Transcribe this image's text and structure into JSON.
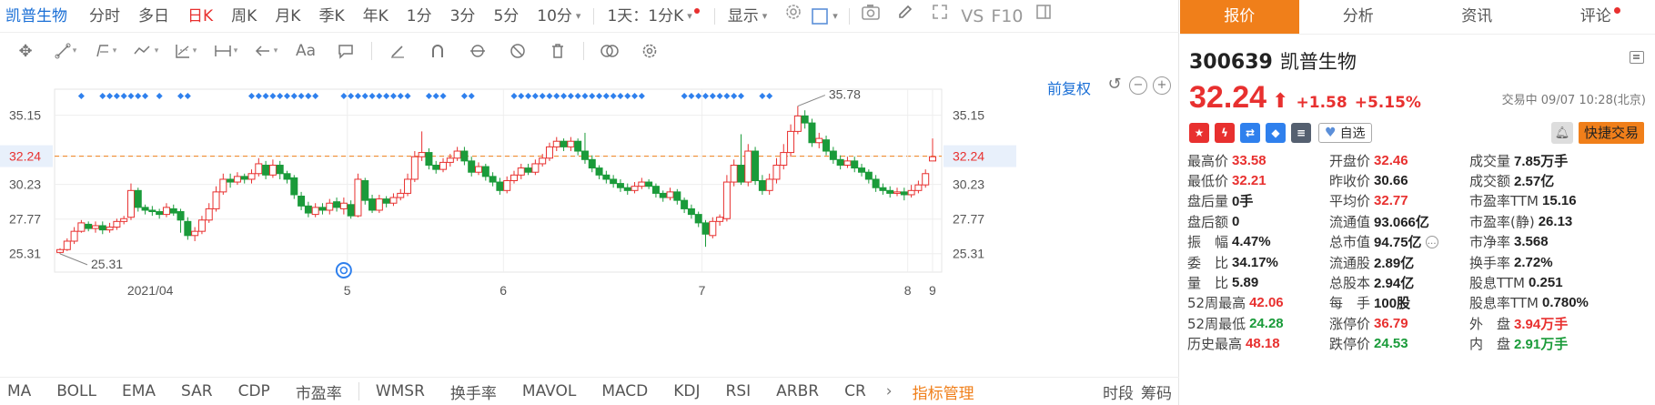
{
  "toolbar": {
    "stock_name": "凯普生物",
    "periods": [
      "分时",
      "多日",
      "日K",
      "周K",
      "月K",
      "季K",
      "年K",
      "1分",
      "3分",
      "5分",
      "10分"
    ],
    "active_period": "日K",
    "multi_period": "1天：1分K",
    "display": "显示",
    "vs_label": "VS",
    "f10_label": "F10"
  },
  "drawing_tools": [
    "move-tool",
    "line-tool",
    "channel-tool",
    "wave-tool",
    "fibonacci-tool",
    "range-tool",
    "arrow-tool",
    "text-tool",
    "note-tool",
    "pen-tool",
    "magnet-tool",
    "hide-tool",
    "lock-tool",
    "delete-tool",
    "toggle-tool",
    "settings-tool"
  ],
  "chart_controls": {
    "adjust_label": "前复权"
  },
  "chart_data": {
    "type": "candlestick",
    "y_ticks": [
      "35.15",
      "32.24",
      "30.23",
      "27.77",
      "25.31"
    ],
    "x_ticks": [
      "2021/04",
      "5",
      "6",
      "7",
      "8",
      "9"
    ],
    "ylim": [
      24.0,
      37.0
    ],
    "max_label": "35.78",
    "min_label": "25.31",
    "current_price": 32.24,
    "current_price_label": "32.24",
    "candles": [
      [
        25.4,
        25.6,
        25.3,
        25.7
      ],
      [
        25.6,
        26.2,
        25.5,
        26.4
      ],
      [
        26.2,
        26.9,
        26.0,
        27.2
      ],
      [
        26.9,
        27.5,
        26.8,
        27.7
      ],
      [
        27.4,
        27.1,
        26.9,
        27.6
      ],
      [
        27.1,
        27.3,
        26.8,
        27.6
      ],
      [
        27.3,
        27.0,
        26.7,
        27.6
      ],
      [
        27.0,
        27.2,
        26.8,
        27.5
      ],
      [
        27.2,
        27.6,
        27.0,
        27.8
      ],
      [
        27.6,
        27.8,
        27.4,
        28.0
      ],
      [
        27.9,
        29.8,
        27.7,
        30.3
      ],
      [
        29.8,
        28.6,
        28.3,
        30.0
      ],
      [
        28.6,
        28.4,
        28.1,
        28.8
      ],
      [
        28.4,
        28.3,
        28.0,
        28.7
      ],
      [
        28.3,
        28.1,
        27.8,
        28.5
      ],
      [
        28.1,
        28.6,
        27.9,
        28.9
      ],
      [
        28.5,
        28.2,
        28.0,
        28.8
      ],
      [
        28.3,
        27.7,
        26.8,
        28.5
      ],
      [
        27.6,
        26.6,
        26.3,
        27.9
      ],
      [
        26.6,
        26.9,
        26.2,
        27.2
      ],
      [
        26.9,
        27.7,
        26.7,
        28.0
      ],
      [
        27.7,
        28.5,
        27.5,
        28.9
      ],
      [
        28.5,
        29.7,
        28.3,
        30.1
      ],
      [
        29.7,
        30.6,
        29.5,
        31.0
      ],
      [
        30.6,
        30.4,
        30.0,
        31.0
      ],
      [
        30.4,
        30.8,
        30.2,
        31.1
      ],
      [
        30.8,
        30.6,
        30.3,
        31.0
      ],
      [
        30.6,
        31.0,
        30.3,
        31.3
      ],
      [
        31.0,
        31.7,
        30.8,
        32.1
      ],
      [
        31.6,
        30.9,
        30.6,
        31.9
      ],
      [
        30.9,
        31.6,
        30.7,
        32.0
      ],
      [
        31.6,
        31.0,
        30.6,
        31.9
      ],
      [
        31.0,
        30.6,
        30.3,
        31.2
      ],
      [
        30.7,
        29.5,
        29.2,
        30.9
      ],
      [
        29.4,
        28.7,
        28.4,
        29.7
      ],
      [
        28.7,
        28.2,
        27.9,
        29.0
      ],
      [
        28.1,
        28.6,
        27.9,
        28.9
      ],
      [
        28.6,
        28.4,
        28.1,
        28.9
      ],
      [
        28.4,
        28.9,
        28.1,
        29.2
      ],
      [
        29.0,
        28.6,
        28.3,
        29.3
      ],
      [
        28.5,
        28.9,
        28.1,
        29.3
      ],
      [
        28.8,
        28.0,
        27.8,
        29.1
      ],
      [
        28.0,
        30.6,
        27.9,
        31.0
      ],
      [
        30.5,
        29.1,
        28.8,
        30.7
      ],
      [
        29.2,
        28.4,
        28.2,
        29.5
      ],
      [
        28.4,
        29.2,
        28.2,
        29.5
      ],
      [
        29.2,
        28.9,
        28.6,
        29.4
      ],
      [
        28.9,
        29.3,
        28.7,
        29.6
      ],
      [
        29.3,
        29.6,
        29.1,
        29.9
      ],
      [
        29.6,
        30.6,
        29.4,
        31.0
      ],
      [
        30.6,
        32.2,
        30.4,
        32.6
      ],
      [
        32.2,
        32.5,
        31.9,
        34.0
      ],
      [
        32.5,
        31.6,
        31.3,
        32.8
      ],
      [
        31.6,
        31.3,
        31.0,
        31.9
      ],
      [
        31.3,
        31.8,
        31.1,
        32.1
      ],
      [
        31.8,
        32.1,
        31.5,
        32.4
      ],
      [
        32.1,
        32.6,
        31.9,
        32.9
      ],
      [
        32.6,
        31.9,
        31.6,
        32.9
      ],
      [
        31.9,
        31.1,
        30.8,
        32.2
      ],
      [
        31.1,
        31.5,
        30.9,
        31.8
      ],
      [
        31.5,
        30.8,
        30.5,
        31.7
      ],
      [
        30.8,
        30.4,
        30.1,
        31.1
      ],
      [
        30.4,
        29.8,
        29.5,
        30.7
      ],
      [
        29.8,
        30.5,
        29.6,
        30.8
      ],
      [
        30.5,
        30.9,
        30.3,
        31.2
      ],
      [
        30.9,
        31.4,
        30.6,
        31.7
      ],
      [
        31.4,
        31.1,
        30.9,
        31.7
      ],
      [
        31.1,
        31.7,
        30.9,
        32.0
      ],
      [
        31.7,
        32.1,
        31.5,
        32.4
      ],
      [
        32.1,
        32.9,
        31.9,
        33.2
      ],
      [
        32.9,
        33.3,
        32.6,
        33.6
      ],
      [
        33.3,
        32.9,
        32.6,
        33.5
      ],
      [
        32.9,
        33.3,
        32.6,
        33.6
      ],
      [
        33.3,
        32.6,
        32.3,
        33.5
      ],
      [
        32.6,
        32.0,
        31.7,
        33.9
      ],
      [
        32.0,
        31.4,
        31.1,
        32.3
      ],
      [
        31.4,
        30.9,
        30.6,
        31.6
      ],
      [
        30.9,
        30.6,
        30.3,
        31.2
      ],
      [
        30.6,
        30.3,
        30.0,
        30.9
      ],
      [
        30.3,
        30.0,
        29.7,
        30.6
      ],
      [
        30.0,
        29.8,
        29.5,
        30.3
      ],
      [
        29.8,
        30.1,
        29.6,
        30.4
      ],
      [
        30.1,
        30.4,
        29.9,
        30.7
      ],
      [
        30.4,
        30.1,
        29.9,
        30.6
      ],
      [
        30.1,
        29.6,
        29.3,
        30.3
      ],
      [
        29.6,
        29.3,
        29.0,
        29.8
      ],
      [
        29.3,
        29.7,
        29.1,
        30.0
      ],
      [
        29.7,
        29.1,
        28.8,
        29.9
      ],
      [
        29.1,
        28.5,
        28.2,
        29.3
      ],
      [
        28.5,
        28.1,
        27.8,
        28.8
      ],
      [
        28.1,
        27.5,
        27.2,
        28.3
      ],
      [
        27.5,
        26.7,
        25.8,
        27.7
      ],
      [
        26.6,
        27.6,
        26.4,
        27.9
      ],
      [
        27.6,
        27.9,
        27.3,
        28.1
      ],
      [
        27.8,
        30.4,
        27.6,
        30.9
      ],
      [
        30.4,
        31.6,
        30.1,
        32.0
      ],
      [
        31.6,
        30.4,
        30.2,
        33.8
      ],
      [
        30.4,
        32.6,
        30.1,
        33.1
      ],
      [
        32.6,
        30.5,
        30.2,
        32.9
      ],
      [
        30.5,
        29.8,
        29.5,
        30.9
      ],
      [
        29.8,
        30.6,
        29.5,
        31.0
      ],
      [
        30.6,
        31.6,
        30.3,
        32.1
      ],
      [
        31.6,
        32.5,
        31.3,
        33.1
      ],
      [
        32.5,
        34.0,
        32.2,
        34.5
      ],
      [
        34.0,
        35.1,
        33.8,
        35.8
      ],
      [
        35.1,
        34.6,
        34.2,
        35.5
      ],
      [
        34.6,
        33.2,
        32.9,
        34.9
      ],
      [
        33.2,
        33.5,
        32.8,
        33.9
      ],
      [
        33.4,
        32.6,
        32.3,
        33.7
      ],
      [
        32.6,
        32.0,
        31.7,
        32.9
      ],
      [
        32.0,
        31.6,
        31.3,
        32.3
      ],
      [
        31.6,
        31.9,
        31.4,
        32.2
      ],
      [
        31.9,
        31.4,
        31.1,
        32.2
      ],
      [
        31.4,
        31.1,
        30.8,
        31.7
      ],
      [
        31.1,
        30.6,
        30.3,
        31.3
      ],
      [
        30.6,
        30.0,
        29.7,
        30.9
      ],
      [
        30.0,
        29.8,
        29.5,
        30.3
      ],
      [
        29.8,
        29.6,
        29.3,
        30.1
      ],
      [
        29.6,
        29.7,
        29.4,
        30.0
      ],
      [
        29.7,
        29.5,
        29.1,
        30.0
      ],
      [
        29.5,
        29.8,
        29.3,
        30.2
      ],
      [
        29.8,
        30.2,
        29.6,
        30.5
      ],
      [
        30.2,
        31.0,
        30.0,
        31.3
      ],
      [
        31.9,
        32.2,
        32.0,
        33.5
      ]
    ],
    "signal_groups": [
      [
        3,
        1
      ],
      [
        6,
        3
      ],
      [
        9,
        3
      ],
      [
        12,
        1
      ],
      [
        14,
        1
      ],
      [
        17,
        2
      ],
      [
        27,
        9
      ],
      [
        35,
        2
      ],
      [
        40,
        10
      ],
      [
        52,
        3
      ],
      [
        57,
        2
      ],
      [
        64,
        19
      ],
      [
        88,
        9
      ],
      [
        99,
        2
      ]
    ]
  },
  "indicators": {
    "left": [
      "MA",
      "BOLL",
      "EMA",
      "SAR",
      "CDP",
      "市盈率"
    ],
    "right": [
      "WMSR",
      "换手率",
      "MAVOL",
      "MACD",
      "KDJ",
      "RSI",
      "ARBR",
      "CR"
    ],
    "manage": "指标管理",
    "extra": [
      "时段",
      "筹码"
    ]
  },
  "quote": {
    "tabs": [
      "报价",
      "分析",
      "资讯",
      "评论"
    ],
    "code": "300639",
    "name": "凯普生物",
    "price": "32.24",
    "change": "+1.58",
    "change_pct": "+5.15%",
    "status": "交易中 09/07 10:28(北京)",
    "watch_label": "自选",
    "quick_trade": "快捷交易",
    "icons": [
      {
        "name": "china-flag-icon",
        "color": "#e8302f"
      },
      {
        "name": "lightning-icon",
        "color": "#e8302f"
      },
      {
        "name": "shuffle-icon",
        "color": "#2f80ed"
      },
      {
        "name": "tag-icon",
        "color": "#2f80ed"
      },
      {
        "name": "document-icon",
        "color": "#556070"
      }
    ],
    "rows": [
      [
        {
          "k": "最高价",
          "v": "33.58",
          "c": "red"
        },
        {
          "k": "开盘价",
          "v": "32.46",
          "c": "red"
        },
        {
          "k": "成交量",
          "v": "7.85万手",
          "c": "dark"
        }
      ],
      [
        {
          "k": "最低价",
          "v": "32.21",
          "c": "red"
        },
        {
          "k": "昨收价",
          "v": "30.66",
          "c": "dark"
        },
        {
          "k": "成交额",
          "v": "2.57亿",
          "c": "dark"
        }
      ],
      [
        {
          "k": "盘后量",
          "v": "0手",
          "c": "dark"
        },
        {
          "k": "平均价",
          "v": "32.77",
          "c": "red"
        },
        {
          "k": "市盈率TTM",
          "v": "15.16",
          "c": "dark"
        }
      ],
      [
        {
          "k": "盘后额",
          "v": "0",
          "c": "dark"
        },
        {
          "k": "流通值",
          "v": "93.066亿",
          "c": "dark"
        },
        {
          "k": "市盈率(静)",
          "v": "26.13",
          "c": "dark"
        }
      ],
      [
        {
          "k": "振　幅",
          "v": "4.47%",
          "c": "dark"
        },
        {
          "k": "总市值",
          "v": "94.75亿",
          "c": "dark",
          "info": true
        },
        {
          "k": "市净率",
          "v": "3.568",
          "c": "dark"
        }
      ],
      [
        {
          "k": "委　比",
          "v": "34.17%",
          "c": "dark"
        },
        {
          "k": "流通股",
          "v": "2.89亿",
          "c": "dark"
        },
        {
          "k": "换手率",
          "v": "2.72%",
          "c": "dark"
        }
      ],
      [
        {
          "k": "量　比",
          "v": "5.89",
          "c": "dark"
        },
        {
          "k": "总股本",
          "v": "2.94亿",
          "c": "dark"
        },
        {
          "k": "股息TTM",
          "v": "0.251",
          "c": "dark"
        }
      ],
      [
        {
          "k": "52周最高",
          "v": "42.06",
          "c": "red"
        },
        {
          "k": "每　手",
          "v": "100股",
          "c": "dark"
        },
        {
          "k": "股息率TTM",
          "v": "0.780%",
          "c": "dark"
        }
      ],
      [
        {
          "k": "52周最低",
          "v": "24.28",
          "c": "green"
        },
        {
          "k": "涨停价",
          "v": "36.79",
          "c": "red"
        },
        {
          "k": "外　盘",
          "v": "3.94万手",
          "c": "red"
        }
      ],
      [
        {
          "k": "历史最高",
          "v": "48.18",
          "c": "red"
        },
        {
          "k": "跌停价",
          "v": "24.53",
          "c": "green"
        },
        {
          "k": "内　盘",
          "v": "2.91万手",
          "c": "green"
        }
      ]
    ]
  }
}
